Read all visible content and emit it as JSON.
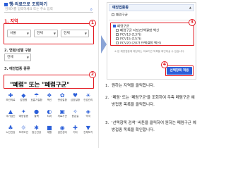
{
  "left": {
    "search_title": "행·의료으로 조회하기",
    "search_placeholder": "검색어를 입력하세요 또는 주소 입력",
    "region_title": "1. 지역",
    "selects": [
      "서울",
      "전체",
      "전체"
    ],
    "age_label": "2. 연령/성별 구분",
    "age_value": "전체",
    "disease_title": "3. 예방접종 종류",
    "quote_text": "\"폐렴\" 또는 \"폐렴구균\"",
    "grid_items": [
      {
        "icon": "✚",
        "label": "보건의료"
      },
      {
        "icon": "◆",
        "label": "감염병"
      },
      {
        "icon": "☂",
        "label": "호흡기질환"
      },
      {
        "icon": "❖",
        "label": "백신"
      },
      {
        "icon": "✿",
        "label": "만성질환"
      },
      {
        "icon": "♥",
        "label": "심장질환"
      },
      {
        "icon": "☀",
        "label": "건강관리"
      },
      {
        "icon": "▲",
        "label": "국가검진"
      },
      {
        "icon": "✦",
        "label": "예방접종"
      },
      {
        "icon": "●",
        "label": "결핵"
      },
      {
        "icon": "◐",
        "label": "치과"
      },
      {
        "icon": "▣",
        "label": "의료기관"
      },
      {
        "icon": "✧",
        "label": "응급실"
      },
      {
        "icon": "◈",
        "label": "약국"
      },
      {
        "icon": "♣",
        "label": "노인건강"
      },
      {
        "icon": "☼",
        "label": "모자보건"
      },
      {
        "icon": "✱",
        "label": "정신건강"
      },
      {
        "icon": "■",
        "label": "재활"
      },
      {
        "icon": "◉",
        "label": "검진센터"
      },
      {
        "icon": "✚",
        "label": "기타"
      },
      {
        "icon": "▼",
        "label": "전체보기"
      }
    ]
  },
  "right": {
    "header": "예방접종종",
    "top_check": "폐렴구균",
    "options": [
      {
        "label": "폐렴구균",
        "checked": true
      },
      {
        "label": "폐렴구균 다당/단백결합 백신",
        "checked": false
      },
      {
        "label": "PCV13 (13가)",
        "checked": false
      },
      {
        "label": "PCV15 (15가)",
        "checked": false
      },
      {
        "label": "PCV20 (20가 단백결합 백신)",
        "checked": false
      }
    ],
    "note": "※ 본 예방접종에 해당하는 의료기관 목록을 확인하실 수 있습니다.",
    "apply_button": "선택항목 적용"
  },
  "badges": [
    "1",
    "2",
    "3",
    "4"
  ],
  "steps": [
    {
      "num": "1.",
      "text": "원하는 지역을 클릭합니다."
    },
    {
      "num": "2.",
      "text": "'폐렴' 또는 '폐렴구균'을 조회하여 우측 폐렴구균 예방접종 목록을 클릭합니다."
    },
    {
      "num": "3.",
      "text": "'선택항목 검색' 버튼을 클릭하여 원하는 폐렴구균 예방접종 목록을 확인합니다."
    }
  ],
  "colors": {
    "accent": "#2b5fd9",
    "highlight": "#e31b23"
  }
}
